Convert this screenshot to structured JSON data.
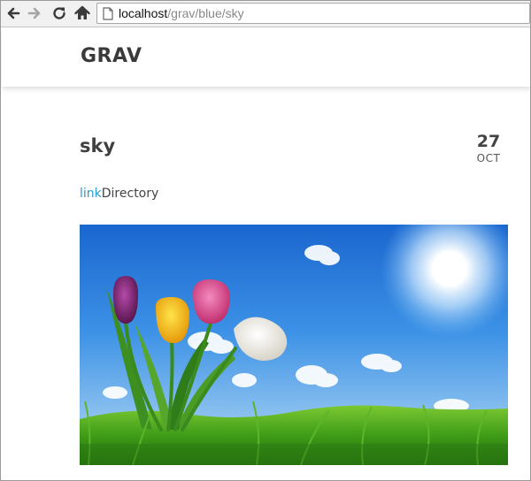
{
  "browser": {
    "url_host": "localhost",
    "url_path": "/grav/blue/sky"
  },
  "site": {
    "logo": "GRAV"
  },
  "post": {
    "title": "sky",
    "date_day": "27",
    "date_month": "OCT",
    "taxonomy_link": "link",
    "taxonomy_text": "Directory"
  },
  "icons": {
    "back": "arrow-left-icon",
    "forward": "arrow-right-icon",
    "reload": "reload-icon",
    "home": "home-icon",
    "page": "page-icon"
  },
  "colors": {
    "link": "#2a9bd6",
    "sky_top": "#1b6fd6",
    "grass": "#3c9a1a"
  }
}
